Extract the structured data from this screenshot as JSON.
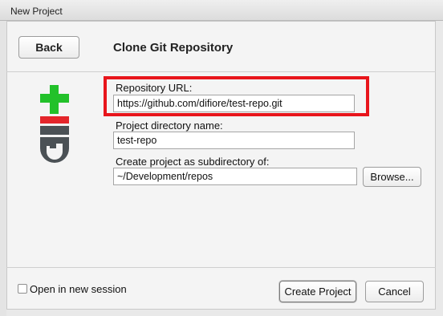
{
  "window": {
    "title": "New Project"
  },
  "header": {
    "back_label": "Back",
    "page_title": "Clone Git Repository"
  },
  "logo": {
    "colors": {
      "plus": "#22c12a",
      "bar": "#e4262b",
      "gi": "#4b5155"
    }
  },
  "form": {
    "repo_url_label": "Repository URL:",
    "repo_url_value": "https://github.com/difiore/test-repo.git",
    "dir_name_label": "Project directory name:",
    "dir_name_value": "test-repo",
    "subdir_label": "Create project as subdirectory of:",
    "subdir_value": "~/Development/repos",
    "browse_label": "Browse..."
  },
  "annotation": {
    "highlight_color": "#e8151b"
  },
  "footer": {
    "new_session_label": "Open in new session",
    "new_session_checked": false,
    "create_label": "Create Project",
    "cancel_label": "Cancel"
  }
}
